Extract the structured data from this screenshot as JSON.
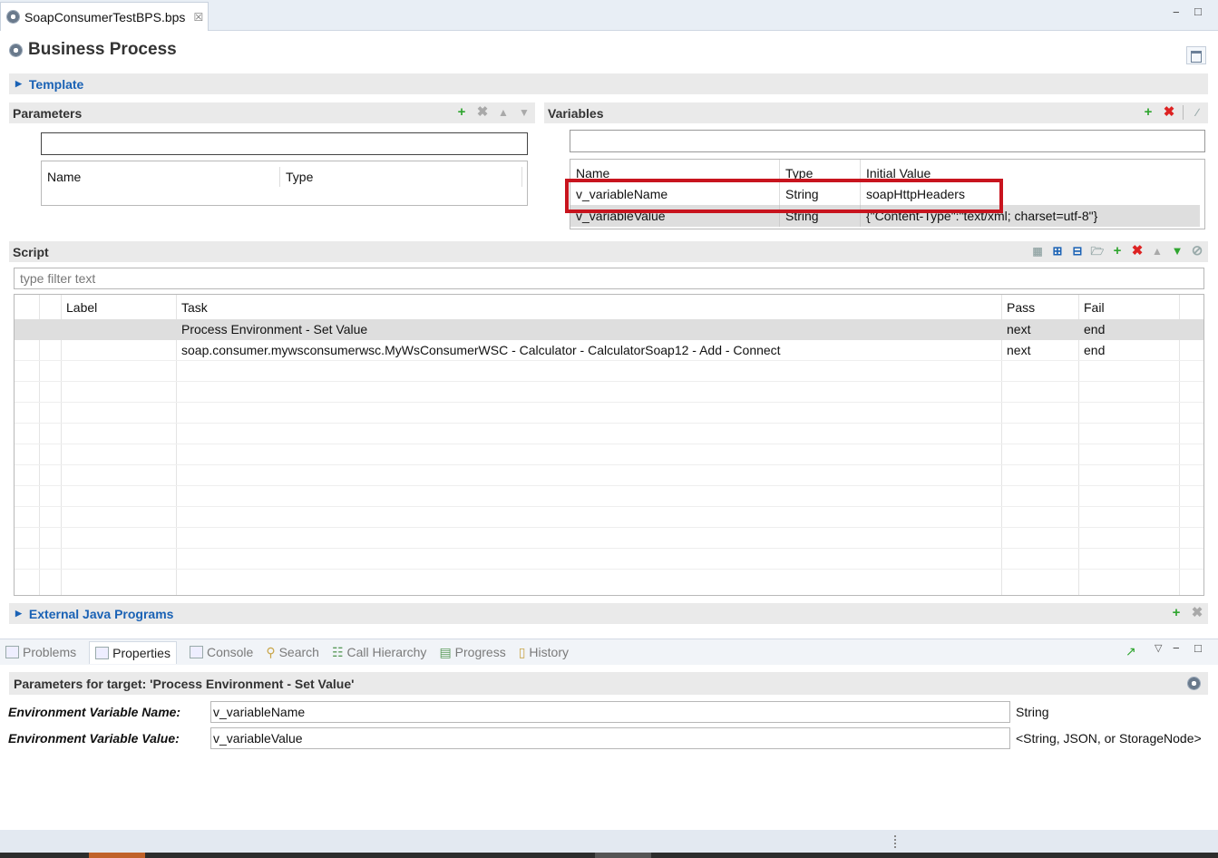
{
  "editor_tab": {
    "title": "SoapConsumerTestBPS.bps",
    "close": "☒"
  },
  "window": {
    "minimize": "−",
    "maximize": "□"
  },
  "header": {
    "title": "Business Process"
  },
  "template": {
    "title": "Template"
  },
  "parameters": {
    "title": "Parameters",
    "columns": [
      "Name",
      "Type"
    ],
    "filter_value": ""
  },
  "variables": {
    "title": "Variables",
    "columns": [
      "Name",
      "Type",
      "Initial Value"
    ],
    "rows": [
      {
        "name": "v_variableName",
        "type": "String",
        "initial_value": "soapHttpHeaders"
      },
      {
        "name": "v_variableValue",
        "type": "String",
        "initial_value": "{\"Content-Type\":\"text/xml; charset=utf-8\"}"
      }
    ]
  },
  "script": {
    "title": "Script",
    "filter_placeholder": "type filter text",
    "columns": [
      "Label",
      "Task",
      "Pass",
      "Fail"
    ],
    "rows": [
      {
        "label": "",
        "task": "Process Environment - Set Value",
        "pass": "next",
        "fail": "end"
      },
      {
        "label": "",
        "task": "soap.consumer.mywsconsumerwsc.MyWsConsumerWSC - Calculator - CalculatorSoap12 - Add - Connect",
        "pass": "next",
        "fail": "end"
      }
    ]
  },
  "external": {
    "title": "External Java Programs"
  },
  "views": {
    "tabs": [
      "Problems",
      "Properties",
      "Console",
      "Search",
      "Call Hierarchy",
      "Progress",
      "History"
    ],
    "active": "Properties"
  },
  "properties": {
    "header": "Parameters for target: 'Process Environment - Set Value'",
    "fields": [
      {
        "label": "Environment Variable Name:",
        "value": "v_variableName",
        "hint": "String"
      },
      {
        "label": "Environment Variable Value:",
        "value": "v_variableValue",
        "hint": "<String, JSON, or StorageNode>"
      }
    ]
  },
  "colors": {
    "accent": "#1a62b5",
    "highlight": "#c8141e",
    "add": "#2fa52f",
    "delete": "#dd2222"
  }
}
